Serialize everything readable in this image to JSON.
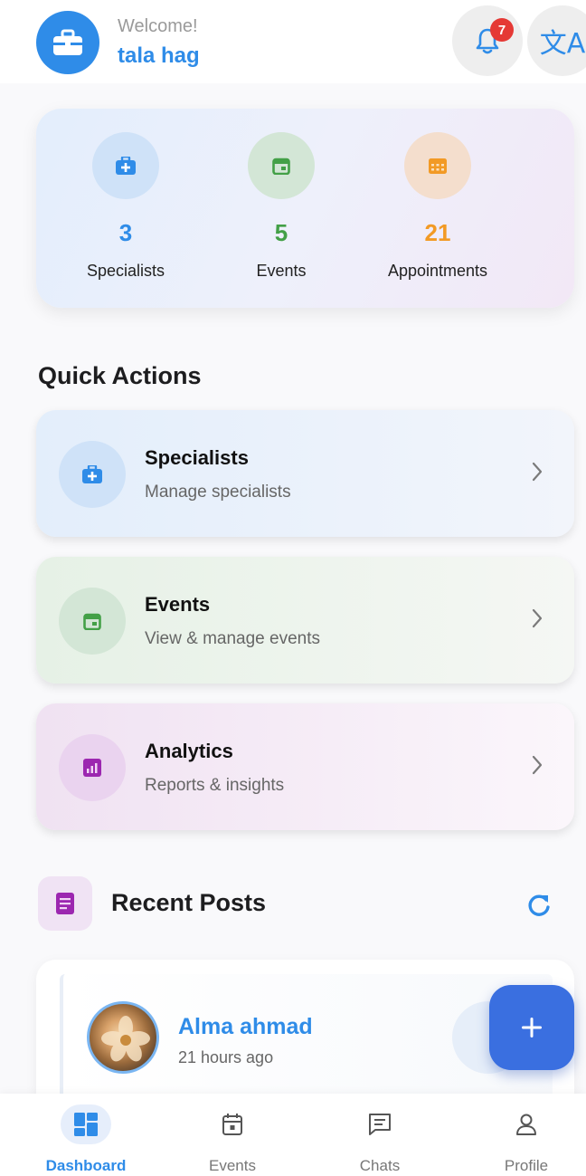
{
  "header": {
    "welcome": "Welcome!",
    "username": "tala hag",
    "notification_count": "7",
    "language_icon": "translate-icon"
  },
  "stats": [
    {
      "value": "3",
      "label": "Specialists",
      "color": "#2f8ce8",
      "icon": "medical-bag-icon"
    },
    {
      "value": "5",
      "label": "Events",
      "color": "#43a047",
      "icon": "calendar-icon"
    },
    {
      "value": "21",
      "label": "Appointments",
      "color": "#f29a25",
      "icon": "calendar-grid-icon"
    }
  ],
  "quick_actions": {
    "title": "Quick Actions",
    "items": [
      {
        "title": "Specialists",
        "subtitle": "Manage specialists",
        "color": "#2f8ce8",
        "icon": "medical-bag-icon"
      },
      {
        "title": "Events",
        "subtitle": "View & manage events",
        "color": "#43a047",
        "icon": "calendar-icon"
      },
      {
        "title": "Analytics",
        "subtitle": "Reports & insights",
        "color": "#9c27b0",
        "icon": "analytics-icon"
      }
    ]
  },
  "recent_posts": {
    "title": "Recent Posts",
    "posts": [
      {
        "author": "Alma ahmad",
        "time": "21 hours ago"
      }
    ]
  },
  "bottom_nav": [
    {
      "label": "Dashboard",
      "icon": "dashboard-icon",
      "active": true
    },
    {
      "label": "Events",
      "icon": "calendar-icon",
      "active": false
    },
    {
      "label": "Chats",
      "icon": "chat-icon",
      "active": false
    },
    {
      "label": "Profile",
      "icon": "profile-icon",
      "active": false
    }
  ],
  "colors": {
    "accent": "#2f8ce8",
    "fab": "#3a6fe0",
    "badge": "#e53935"
  }
}
